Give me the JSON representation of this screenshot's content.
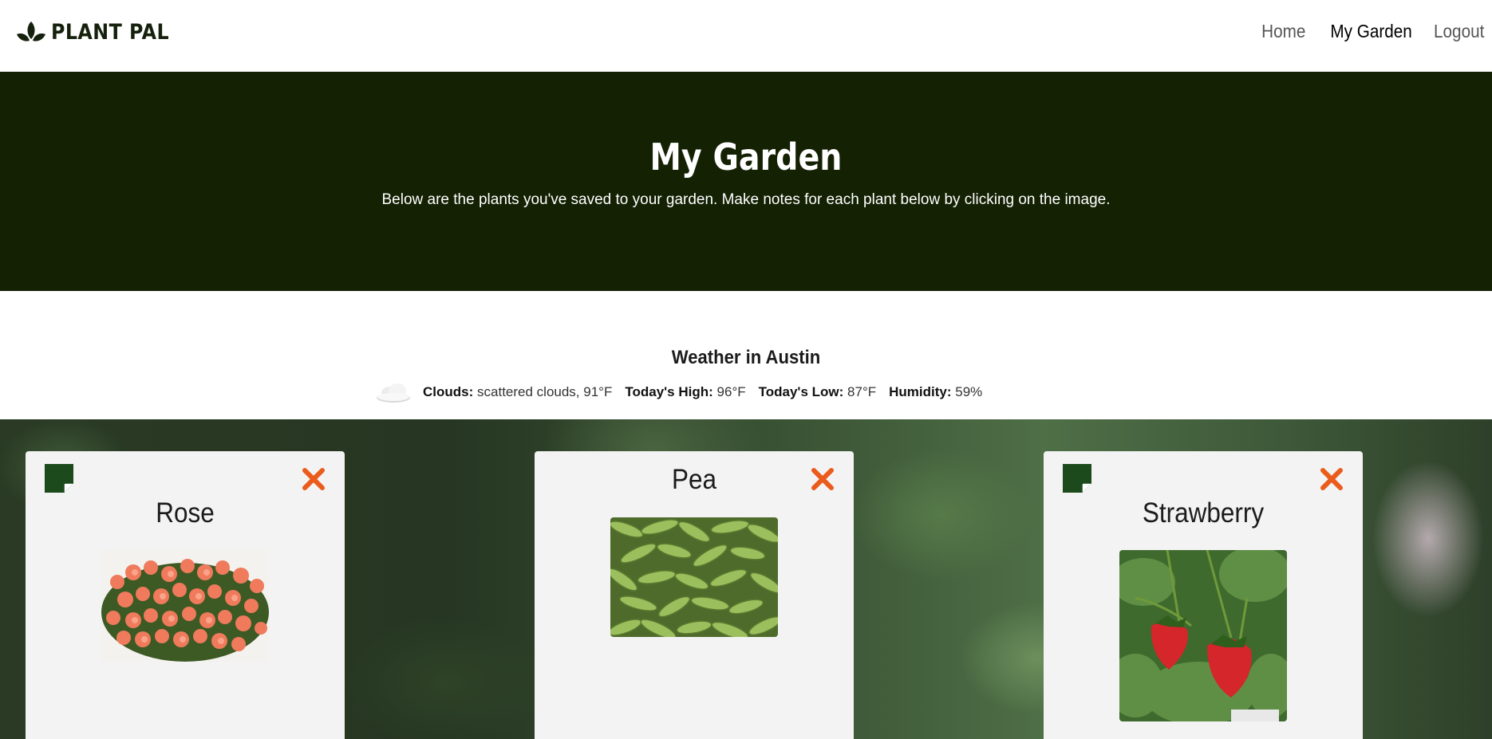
{
  "brand": {
    "name": "PLANT PAL",
    "icon": "leaves-icon"
  },
  "nav": {
    "links": [
      {
        "label": "Home",
        "active": false
      },
      {
        "label": "My Garden",
        "active": true
      },
      {
        "label": "Logout",
        "active": false
      }
    ]
  },
  "hero": {
    "title": "My Garden",
    "subtitle": "Below are the plants you've saved to your garden. Make notes for each plant below by clicking on the image."
  },
  "weather": {
    "title": "Weather in Austin",
    "icon": "cloud-icon",
    "clouds_label": "Clouds:",
    "clouds_value": "scattered clouds, 91°F",
    "high_label": "Today's High:",
    "high_value": "96°F",
    "low_label": "Today's Low:",
    "low_value": "87°F",
    "humidity_label": "Humidity:",
    "humidity_value": "59%"
  },
  "plants": [
    {
      "name": "Rose",
      "has_note_icon": true,
      "image": "rose-bush-photo"
    },
    {
      "name": "Pea",
      "has_note_icon": false,
      "image": "pea-pods-photo"
    },
    {
      "name": "Strawberry",
      "has_note_icon": true,
      "image": "strawberries-photo"
    }
  ],
  "colors": {
    "hero_bg": "#142103",
    "note_icon": "#1d4a1d",
    "close_icon": "#ea5b1c",
    "card_bg": "#f3f3f3"
  }
}
